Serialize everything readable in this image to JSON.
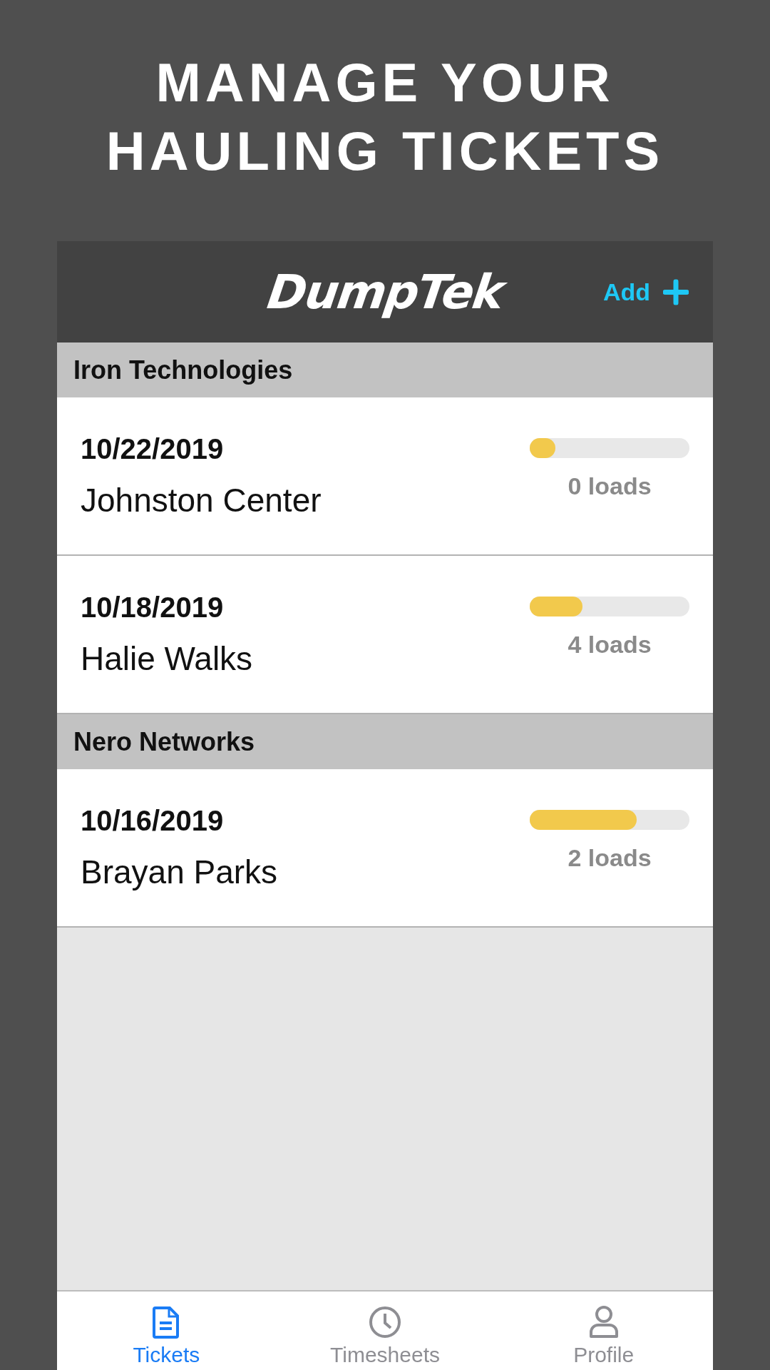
{
  "headline": [
    "MANAGE YOUR",
    "HAULING TICKETS"
  ],
  "app_bar": {
    "logo": "DumpTek",
    "add_button": "Add"
  },
  "groups": [
    {
      "name": "Iron Technologies",
      "tickets": [
        {
          "date": "10/22/2019",
          "name": "Johnston Center",
          "level": 0.16,
          "loads": "0 loads"
        },
        {
          "date": "10/18/2019",
          "name": "Halie Walks",
          "level": 0.33,
          "loads": "4 loads"
        }
      ]
    },
    {
      "name": "Nero Networks",
      "tickets": [
        {
          "date": "10/16/2019",
          "name": "Brayan Parks",
          "level": 0.67,
          "loads": "2 loads"
        }
      ]
    }
  ],
  "tabs": [
    {
      "label": "Tickets",
      "selected": true
    },
    {
      "label": "Timesheets",
      "selected": false
    },
    {
      "label": "Profile",
      "selected": false
    }
  ]
}
